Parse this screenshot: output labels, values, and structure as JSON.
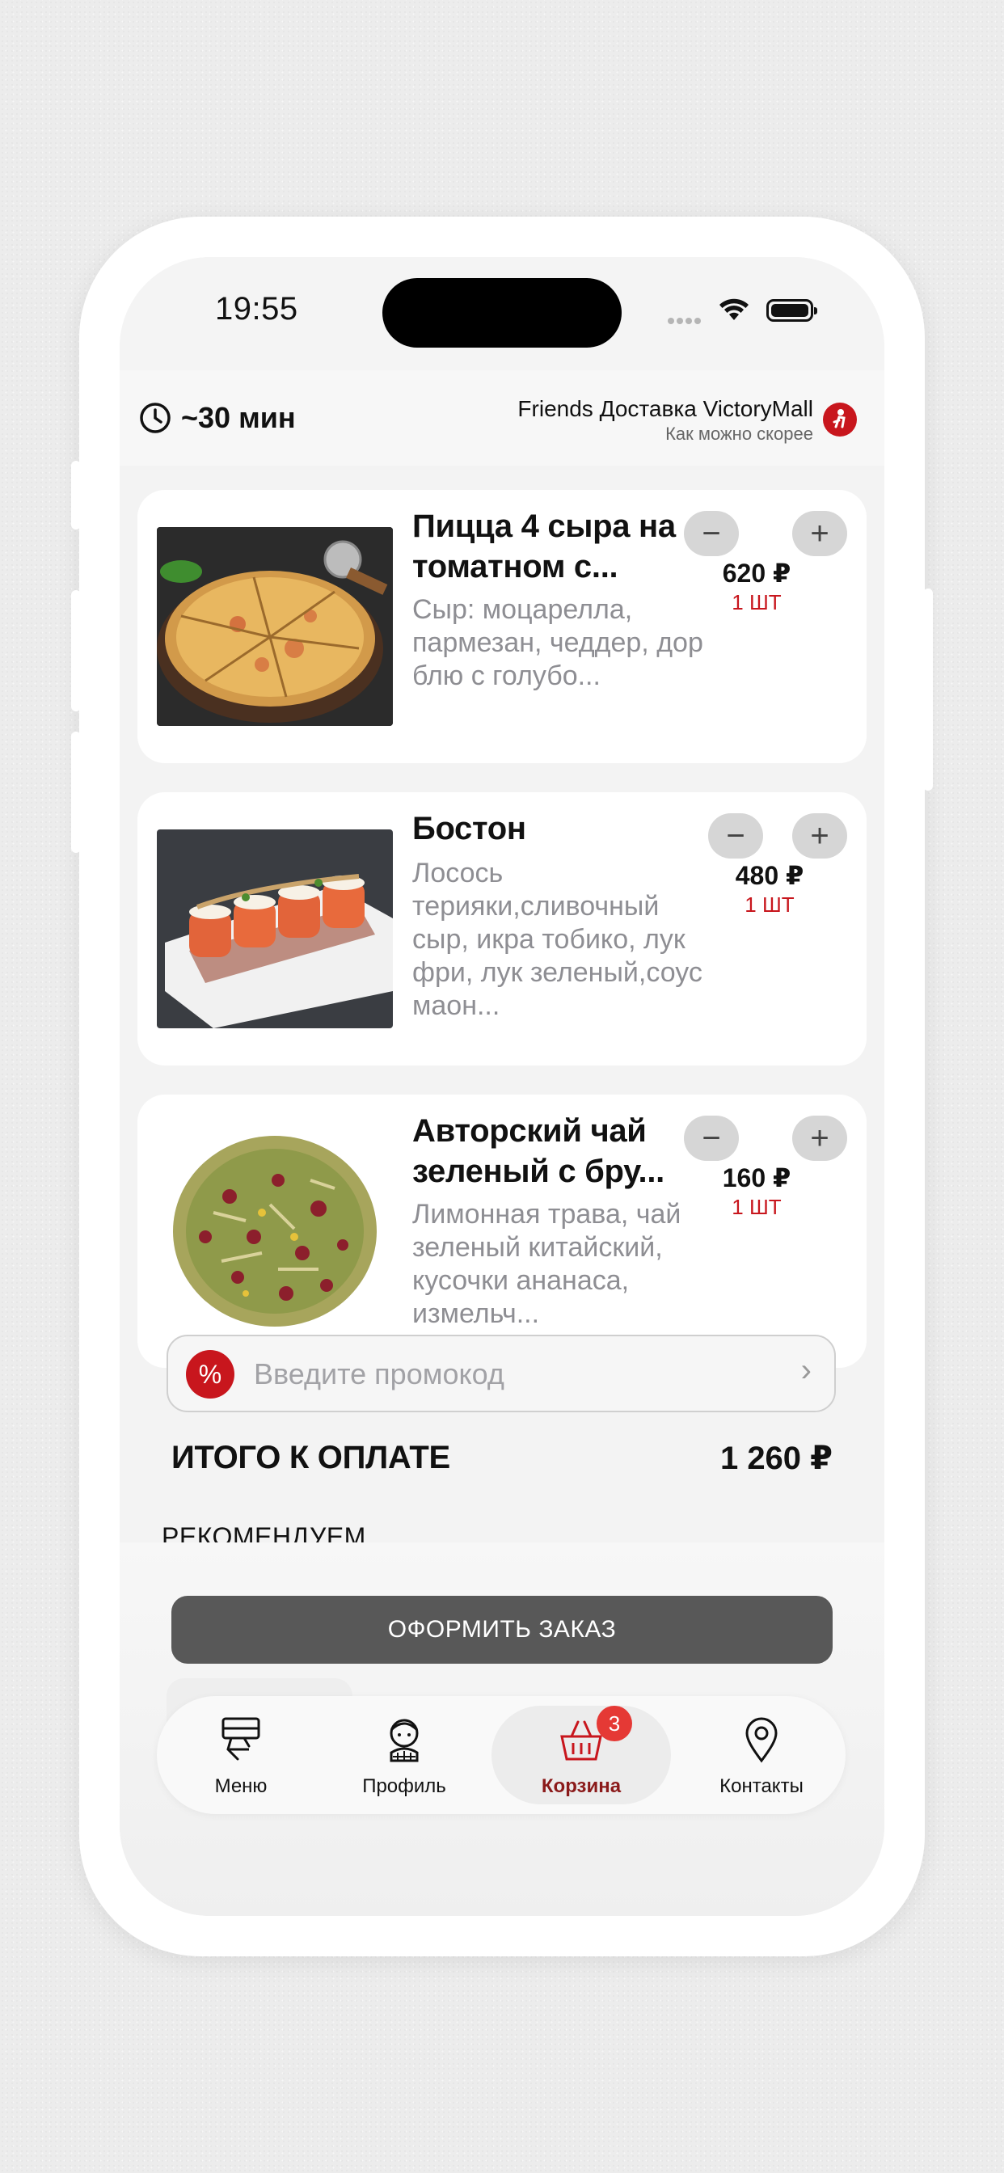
{
  "status_bar": {
    "time": "19:55"
  },
  "header": {
    "eta": "~30 мин",
    "shop_name": "Friends Доставка VictoryMall",
    "shop_subtitle": "Как можно скорее"
  },
  "cart": {
    "items": [
      {
        "title": "Пицца 4 сыра на томатном с...",
        "description": "Сыр: моцарелла, пармезан, чеддер, дор блю с голубо...",
        "price": "620 ₽",
        "count": "1 ШТ",
        "image": "pizza-photo"
      },
      {
        "title": "Бостон",
        "description": "Лосось терияки,сливочный сыр, икра тобико, лук фри, лук зеленый,соус маон...",
        "price": "480 ₽",
        "count": "1 ШТ",
        "image": "sushi-roll-photo"
      },
      {
        "title": "Авторский чай зеленый с бру...",
        "description": "Лимонная трава, чай зеленый китайский, кусочки ананаса, измельч...",
        "price": "160 ₽",
        "count": "1 ШТ",
        "image": "tea-blend-photo"
      }
    ],
    "decrease_symbol": "−",
    "increase_symbol": "+"
  },
  "promo": {
    "badge": "%",
    "placeholder": "Введите промокод",
    "arrow": "›"
  },
  "total": {
    "label": "ИТОГО К ОПЛАТЕ",
    "value": "1 260 ₽"
  },
  "recommend_label": "РЕКОМЕНДУЕМ",
  "checkout_label": "ОФОРМИТЬ ЗАКАЗ",
  "tabs": [
    {
      "label": "Меню",
      "icon": "menu-tray-icon"
    },
    {
      "label": "Профиль",
      "icon": "profile-face-icon"
    },
    {
      "label": "Корзина",
      "icon": "basket-icon",
      "badge": "3",
      "active": true
    },
    {
      "label": "Контакты",
      "icon": "location-pin-icon"
    }
  ],
  "colors": {
    "accent": "#c8161d",
    "active_tab": "#8b1a1a",
    "badge": "#e53935",
    "checkout": "#585858"
  }
}
